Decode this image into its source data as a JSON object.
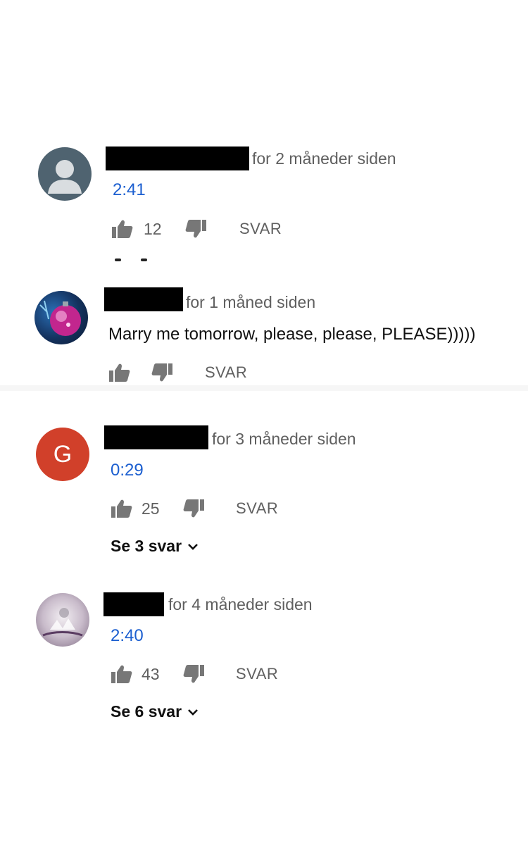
{
  "comments": [
    {
      "time": "for 2 måneder siden",
      "text": "2:41",
      "likes": "12",
      "reply_label": "SVAR",
      "avatar": "default-user-icon"
    },
    {
      "time": "for 1 måned siden",
      "text": "Marry me tomorrow, please, please, PLEASE)))))",
      "likes": "",
      "reply_label": "SVAR",
      "avatar": "christmas-ornament-photo"
    },
    {
      "time": "for 3 måneder siden",
      "text": "0:29",
      "likes": "25",
      "reply_label": "SVAR",
      "avatar_letter": "G",
      "view_replies": "Se 3 svar"
    },
    {
      "time": "for 4 måneder siden",
      "text": "2:40",
      "likes": "43",
      "reply_label": "SVAR",
      "avatar": "crystal-photo",
      "view_replies": "Se 6 svar"
    }
  ],
  "colors": {
    "link": "#1c5fd0",
    "avatar_g": "#d1402a",
    "avatar_default": "#4f6370",
    "muted": "#606060"
  }
}
